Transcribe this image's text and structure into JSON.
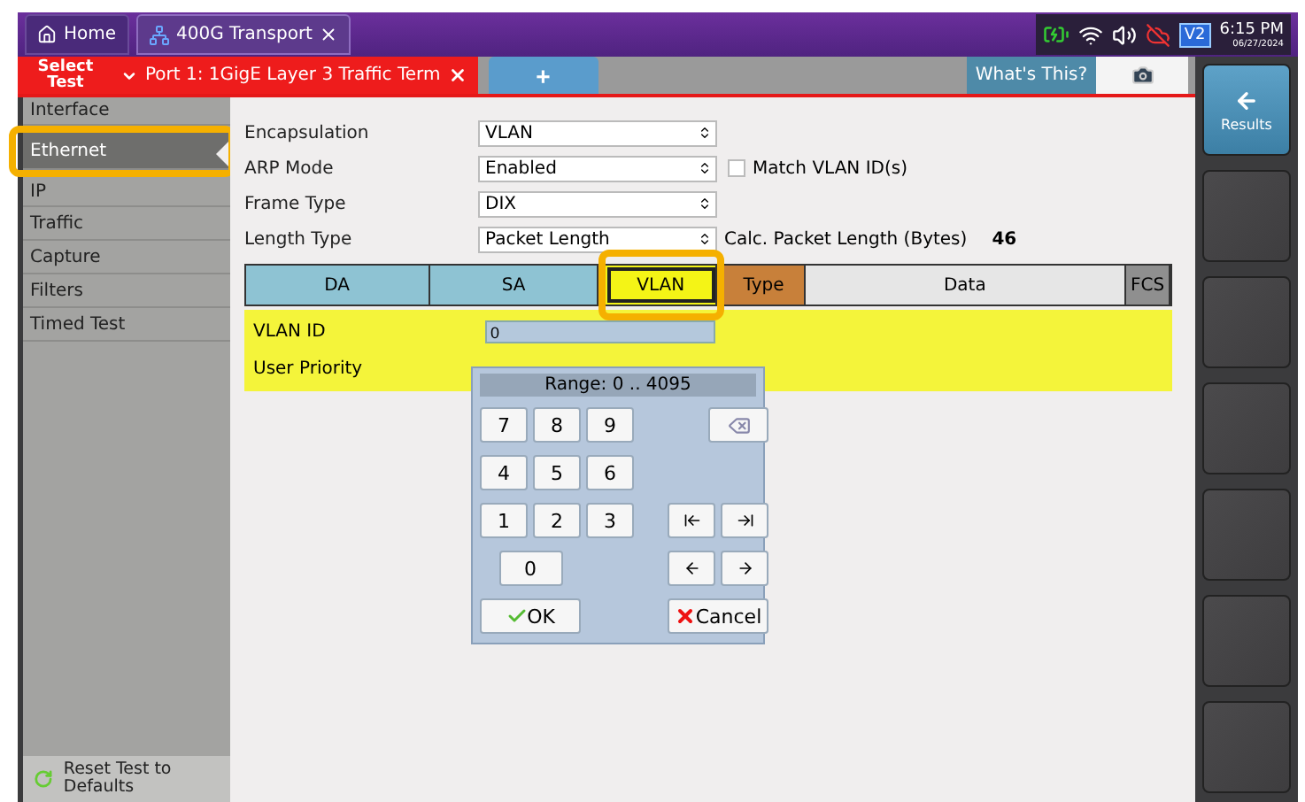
{
  "top_tabs": [
    {
      "kind": "home",
      "label": "Home",
      "selected": false
    },
    {
      "kind": "app",
      "label": "400G Transport",
      "selected": true
    }
  ],
  "status": {
    "badge": "V2",
    "time": "6:15 PM",
    "date": "06/27/2024"
  },
  "test_bar": {
    "select_test": "Select Test",
    "port_tab": "Port 1: 1GigE Layer 3 Traffic Term",
    "add_tab": "+",
    "whats_this": "What's This?"
  },
  "sidebar": {
    "items": [
      {
        "label": "Interface",
        "selected": false
      },
      {
        "label": "Ethernet",
        "selected": true
      },
      {
        "label": "IP",
        "selected": false
      },
      {
        "label": "Traffic",
        "selected": false
      },
      {
        "label": "Capture",
        "selected": false
      },
      {
        "label": "Filters",
        "selected": false
      },
      {
        "label": "Timed Test",
        "selected": false
      }
    ],
    "reset": "Reset Test to Defaults"
  },
  "form": [
    {
      "label": "Encapsulation",
      "value": "VLAN"
    },
    {
      "label": "ARP Mode",
      "value": "Enabled",
      "checkbox": {
        "label": "Match VLAN ID(s)",
        "checked": false
      }
    },
    {
      "label": "Frame Type",
      "value": "DIX"
    },
    {
      "label": "Length Type",
      "value": "Packet Length",
      "info": {
        "label": "Calc. Packet Length (Bytes)",
        "value": "46"
      }
    }
  ],
  "frame": [
    {
      "label": "DA",
      "color": "#8ec3d3",
      "selected": false
    },
    {
      "label": "SA",
      "color": "#8ec3d3",
      "selected": false
    },
    {
      "label": "VLAN",
      "color": "#f4f416",
      "selected": true
    },
    {
      "label": "Type",
      "color": "#c8803a",
      "selected": false
    },
    {
      "label": "Data",
      "color": "#e6e6e6",
      "selected": false
    },
    {
      "label": "FCS",
      "color": "#8f8f8f",
      "selected": false
    }
  ],
  "vlan_panel": {
    "fields": [
      {
        "label": "VLAN ID",
        "value": "0"
      },
      {
        "label": "User Priority"
      }
    ]
  },
  "keypad": {
    "range": "Range: 0 .. 4095",
    "digits": [
      "7",
      "8",
      "9",
      "4",
      "5",
      "6",
      "1",
      "2",
      "3",
      "0"
    ],
    "ok": "OK",
    "cancel": "Cancel"
  },
  "dock": [
    {
      "kind": "action",
      "label": "Results"
    },
    {
      "kind": "blank"
    },
    {
      "kind": "blank"
    },
    {
      "kind": "blank"
    },
    {
      "kind": "blank"
    },
    {
      "kind": "blank"
    },
    {
      "kind": "blank"
    }
  ]
}
